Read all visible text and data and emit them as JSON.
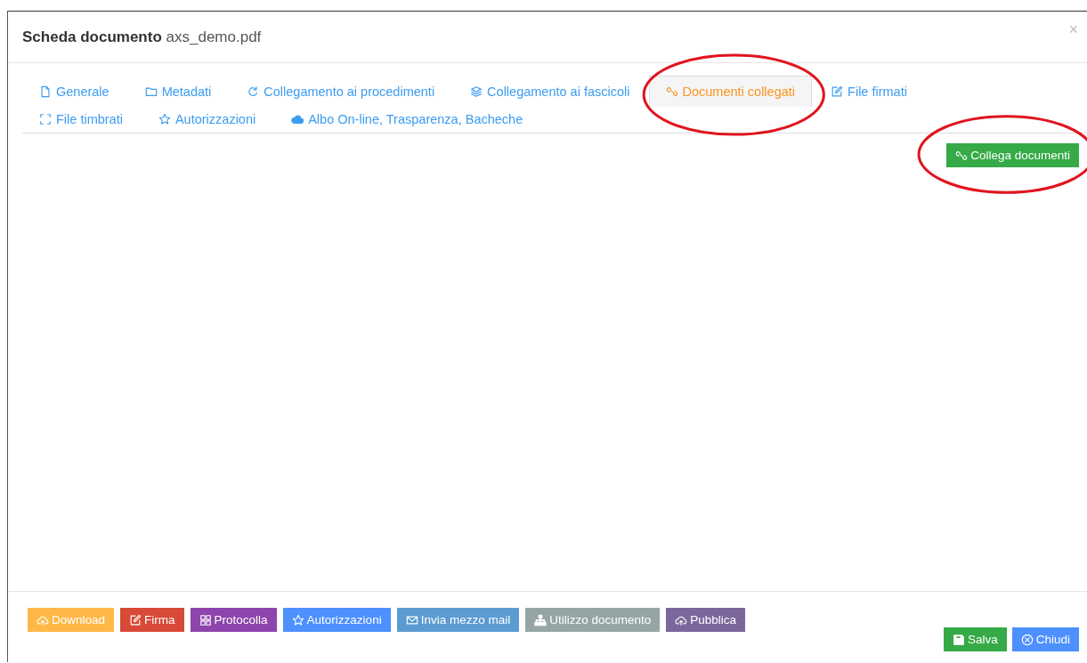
{
  "dialog": {
    "title": "Scheda documento",
    "filename": "axs_demo.pdf",
    "close": "×"
  },
  "tab_rows": [
    [
      {
        "label": "Generale",
        "selected": false,
        "circled": false
      },
      {
        "label": "Metadati",
        "selected": false,
        "circled": false
      },
      {
        "label": "Collegamento ai procedimenti",
        "selected": false,
        "circled": false
      },
      {
        "label": "Collegamento ai fascicoli",
        "selected": false,
        "circled": false
      },
      {
        "label": "Documenti collegati",
        "selected": true,
        "circled": true
      },
      {
        "label": "File firmati",
        "selected": false,
        "circled": false
      }
    ],
    [
      {
        "label": "File timbrati",
        "selected": false,
        "circled": false
      },
      {
        "label": "Autorizzazioni",
        "selected": false,
        "circled": false
      },
      {
        "label": "Albo On-line, Trasparenza, Bacheche",
        "selected": false,
        "circled": false
      }
    ]
  ],
  "action_button": {
    "label": "Collega documenti",
    "color": "#35aa47",
    "circled": true
  },
  "footer_buttons": [
    {
      "label": "Download",
      "color": "#ffb848"
    },
    {
      "label": "Firma",
      "color": "#d84a38"
    },
    {
      "label": "Protocolla",
      "color": "#8e44ad"
    },
    {
      "label": "Autorizzazioni",
      "color": "#4d90fe"
    },
    {
      "label": "Invia mezzo mail",
      "color": "#5b9bd1"
    },
    {
      "label": "Utilizzo documento",
      "color": "#95a5a6"
    },
    {
      "label": "Pubblica",
      "color": "#7c669c"
    }
  ],
  "dialog_buttons": [
    {
      "label": "Salva",
      "color": "#35aa47"
    },
    {
      "label": "Chiudi",
      "color": "#4d90fe"
    }
  ]
}
